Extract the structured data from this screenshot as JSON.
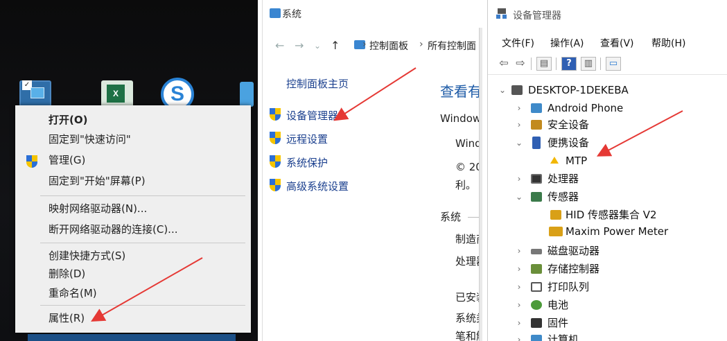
{
  "panel1": {
    "desktop_icons": [
      "this-pc-icon",
      "excel-icon",
      "sogou-browser-icon",
      "edge-icon"
    ],
    "excel_icon_text": "X",
    "sogou_icon_text": "S",
    "menu_items": [
      {
        "label": "打开(O)"
      },
      {
        "label": "固定到\"快速访问\""
      },
      {
        "label": "管理(G)"
      },
      {
        "label": "固定到\"开始\"屏幕(P)"
      },
      {
        "label": "映射网络驱动器(N)..."
      },
      {
        "label": "断开网络驱动器的连接(C)..."
      },
      {
        "label": "创建快捷方式(S)"
      },
      {
        "label": "删除(D)"
      },
      {
        "label": "重命名(M)"
      },
      {
        "label": "属性(R)"
      }
    ]
  },
  "panel2": {
    "window_title": "系统",
    "breadcrumb": [
      "控制面板",
      "所有控制面"
    ],
    "home_link": "控制面板主页",
    "links": [
      "设备管理器",
      "远程设置",
      "系统保护",
      "高级系统设置"
    ],
    "view_heading": "查看有",
    "windows_label": "Windows",
    "wind_text": "Wind",
    "copyright_text": "© 20",
    "li_text": "利。",
    "system_section": "系统",
    "system_rows": [
      "制造商",
      "处理器",
      "已安装",
      "系统类",
      "笔和触"
    ]
  },
  "panel3": {
    "window_title": "设备管理器",
    "menus": [
      "文件(F)",
      "操作(A)",
      "查看(V)",
      "帮助(H)"
    ],
    "toolbar_buttons": [
      "back",
      "forward",
      "properties",
      "help",
      "view",
      "scan"
    ],
    "toolbar_help_glyph": "?",
    "root": "DESKTOP-1DEKEBA",
    "tree": [
      {
        "label": "Android Phone",
        "arrow": "›"
      },
      {
        "label": "安全设备",
        "arrow": "›"
      },
      {
        "label": "便携设备",
        "arrow": "⌄"
      },
      {
        "label": "MTP",
        "arrow": ""
      },
      {
        "label": "处理器",
        "arrow": "›"
      },
      {
        "label": "传感器",
        "arrow": "⌄"
      },
      {
        "label": "HID 传感器集合 V2",
        "arrow": ""
      },
      {
        "label": "Maxim Power Meter",
        "arrow": ""
      },
      {
        "label": "磁盘驱动器",
        "arrow": "›"
      },
      {
        "label": "存储控制器",
        "arrow": "›"
      },
      {
        "label": "打印队列",
        "arrow": "›"
      },
      {
        "label": "电池",
        "arrow": "›"
      },
      {
        "label": "固件",
        "arrow": "›"
      },
      {
        "label": "计算机",
        "arrow": "›"
      }
    ]
  },
  "colors": {
    "annotation_arrow": "#e53935",
    "link_blue": "#1a3f8e",
    "heading_blue": "#1c5aa6"
  }
}
